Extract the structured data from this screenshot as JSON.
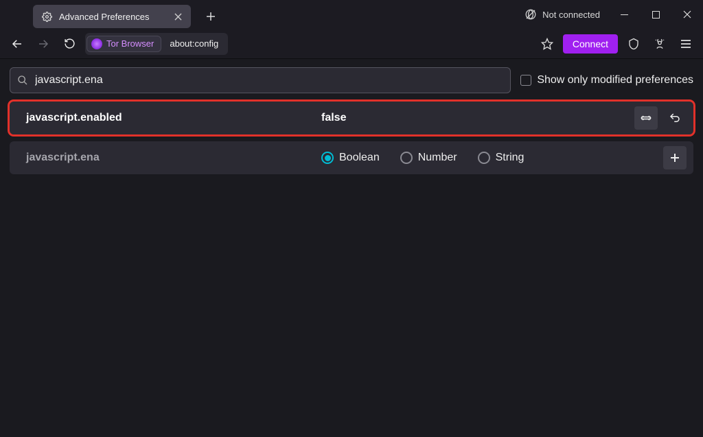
{
  "window": {
    "tab_title": "Advanced Preferences",
    "connection_status": "Not connected"
  },
  "toolbar": {
    "identity_label": "Tor Browser",
    "url": "about:config",
    "connect_label": "Connect"
  },
  "config": {
    "search_value": "javascript.ena",
    "modified_only_label": "Show only modified preferences",
    "rows": [
      {
        "name": "javascript.enabled",
        "value": "false"
      }
    ],
    "new_pref_name": "javascript.ena",
    "type_options": {
      "boolean": "Boolean",
      "number": "Number",
      "string": "String"
    }
  }
}
